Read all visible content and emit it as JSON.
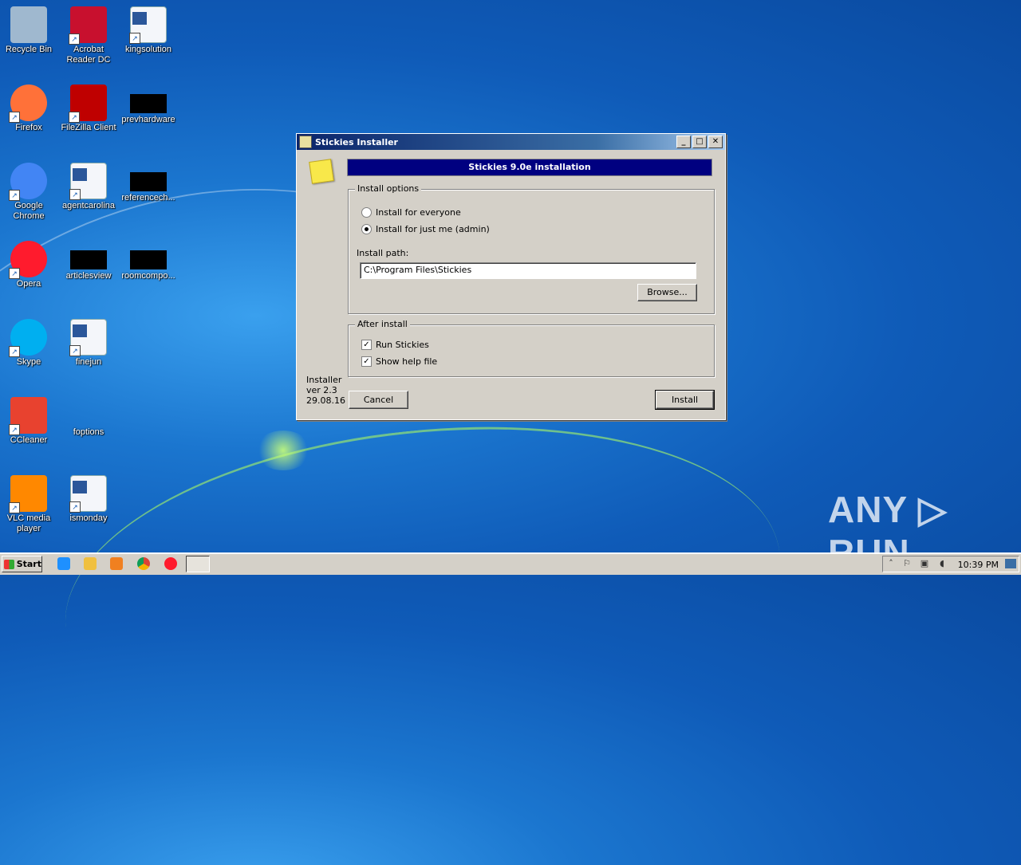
{
  "desktop": {
    "icons": [
      {
        "label": "Recycle Bin",
        "icon": "recycle-bin-icon",
        "color": "#9fb8cf"
      },
      {
        "label": "Acrobat Reader DC",
        "icon": "acrobat-icon",
        "color": "#c8102e"
      },
      {
        "label": "kingsolution",
        "icon": "word-doc-icon",
        "color": "#2b579a"
      },
      {
        "label": "Firefox",
        "icon": "firefox-icon",
        "color": "#ff7139"
      },
      {
        "label": "FileZilla Client",
        "icon": "filezilla-icon",
        "color": "#bf0000"
      },
      {
        "label": "prevhardware",
        "icon": "blank-thumbnail-icon",
        "color": "#000000"
      },
      {
        "label": "Google Chrome",
        "icon": "chrome-icon",
        "color": "#4285f4"
      },
      {
        "label": "agentcarolina",
        "icon": "word-doc-icon",
        "color": "#2b579a"
      },
      {
        "label": "referencech...",
        "icon": "blank-thumbnail-icon",
        "color": "#000000"
      },
      {
        "label": "Opera",
        "icon": "opera-icon",
        "color": "#ff1b2d"
      },
      {
        "label": "articlesview",
        "icon": "blank-thumbnail-icon",
        "color": "#000000"
      },
      {
        "label": "roomcompo...",
        "icon": "blank-thumbnail-icon",
        "color": "#000000"
      },
      {
        "label": "Skype",
        "icon": "skype-icon",
        "color": "#00aff0"
      },
      {
        "label": "finejun",
        "icon": "word-doc-icon",
        "color": "#2b579a"
      },
      {
        "label": "CCleaner",
        "icon": "ccleaner-icon",
        "color": "#e8422f"
      },
      {
        "label": "foptions",
        "icon": "blank-thumbnail-icon",
        "color": "#1b76cf"
      },
      {
        "label": "VLC media player",
        "icon": "vlc-icon",
        "color": "#ff8800"
      },
      {
        "label": "ismonday",
        "icon": "word-doc-icon",
        "color": "#2b579a"
      }
    ]
  },
  "dialog": {
    "title": "Stickies Installer",
    "banner": "Stickies 9.0e installation",
    "install_options_label": "Install options",
    "radio_everyone": "Install for everyone",
    "radio_just_me": "Install for just me (admin)",
    "selected_radio": "just_me",
    "install_path_label": "Install path:",
    "install_path_value": "C:\\Program Files\\Stickies",
    "browse_label": "Browse...",
    "after_install_label": "After install",
    "check_run": "Run Stickies",
    "check_help": "Show help file",
    "version_line1": "Installer",
    "version_line2": "ver 2.3",
    "version_line3": "29.08.16",
    "cancel_label": "Cancel",
    "install_label": "Install",
    "minimize_glyph": "_",
    "maximize_glyph": "□",
    "close_glyph": "✕"
  },
  "taskbar": {
    "start_label": "Start",
    "clock": "10:39 PM",
    "quick_launch": [
      "ie-icon",
      "explorer-icon",
      "media-player-icon",
      "chrome-icon",
      "opera-icon"
    ]
  },
  "watermark": "ANY ▷ RUN"
}
